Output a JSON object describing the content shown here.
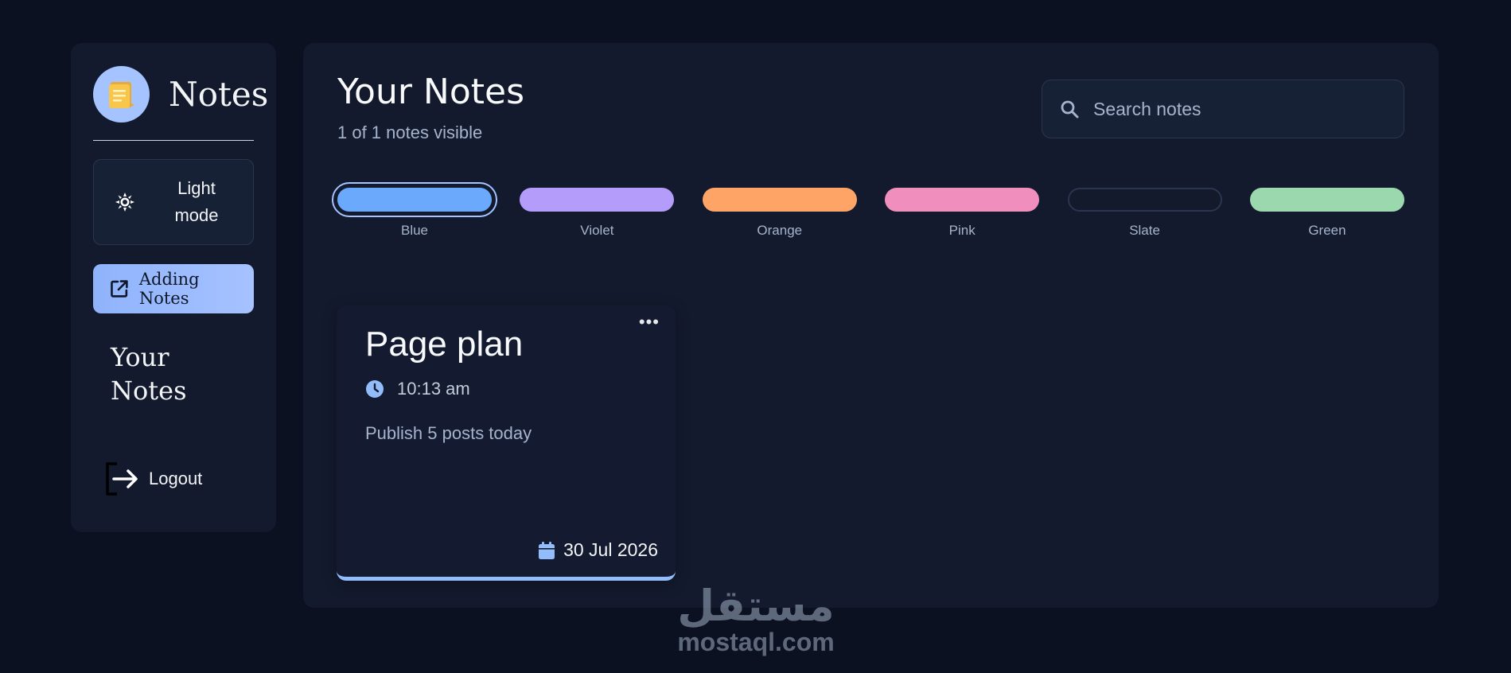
{
  "sidebar": {
    "brand_name": "Notes",
    "mode_label": "Light mode",
    "add_label": "Adding Notes",
    "your_notes_label": "Your Notes",
    "logout_label": "Logout"
  },
  "main": {
    "title": "Your Notes",
    "visible_count": "1 of 1 notes visible",
    "search": {
      "placeholder": "Search notes",
      "value": ""
    }
  },
  "swatches": [
    {
      "label": "Blue",
      "color": "#6aa9fb",
      "selected": true
    },
    {
      "label": "Violet",
      "color": "#b49cfb",
      "selected": false
    },
    {
      "label": "Orange",
      "color": "#fda466",
      "selected": false
    },
    {
      "label": "Pink",
      "color": "#f08fbd",
      "selected": false
    },
    {
      "label": "Slate",
      "color": "#121a2b",
      "selected": false
    },
    {
      "label": "Green",
      "color": "#9cd8ad",
      "selected": false
    }
  ],
  "notes": [
    {
      "title": "Page plan",
      "time": "10:13 am",
      "body": "Publish 5 posts today",
      "date": "30 Jul 2026",
      "color": "#93bcfb"
    }
  ],
  "watermark": {
    "arabic": "مستقل",
    "latin": "mostaql.com"
  },
  "colors": {
    "accent": "#a5c4ff",
    "background": "#0b1120",
    "panel": "#131a2d"
  }
}
